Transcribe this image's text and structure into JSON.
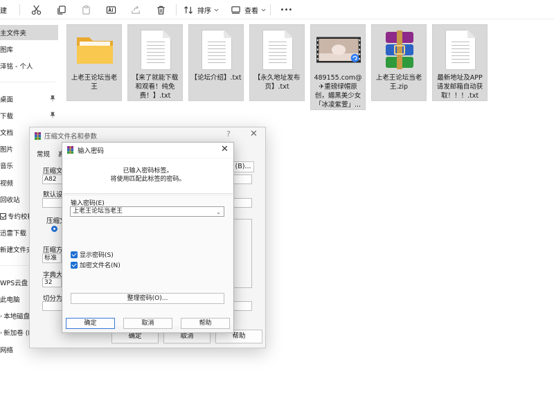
{
  "toolbar": {
    "new_partial": "建",
    "sort_label": "排序",
    "view_label": "查看",
    "more_label": "..."
  },
  "sidebar": {
    "items": [
      {
        "label": "主文件夹",
        "selected": true
      },
      {
        "label": "图库"
      },
      {
        "label": "泽铭 - 个人"
      },
      {
        "label": "桌面",
        "pinned": true
      },
      {
        "label": "下载",
        "pinned": true
      },
      {
        "label": "文档"
      },
      {
        "label": "图片"
      },
      {
        "label": "音乐"
      },
      {
        "label": "视频"
      },
      {
        "label": "回收站"
      },
      {
        "label": "专约校稿",
        "checkbox": true
      },
      {
        "label": "迅雷下载"
      },
      {
        "label": "新建文件夹"
      },
      {
        "label": "WPS云盘"
      },
      {
        "label": "此电脑"
      },
      {
        "label": "本地磁盘"
      },
      {
        "label": "新加卷 (D"
      },
      {
        "label": "网络"
      }
    ]
  },
  "files": [
    {
      "name": "上老王论坛当老王",
      "type": "folder"
    },
    {
      "name": "【来了就能下载和观看！纯免费！】.txt",
      "type": "txt"
    },
    {
      "name": "【论坛介绍】.txt",
      "type": "txt"
    },
    {
      "name": "【永久地址发布页】.txt",
      "type": "txt"
    },
    {
      "name": "489155.com@✈重磅绿帽原创，媚黑美少女「冰凌紫萱」...",
      "type": "video"
    },
    {
      "name": "上老王论坛当老王.zip",
      "type": "zip"
    },
    {
      "name": "最新地址及APP请发邮箱自动获取！！！.txt",
      "type": "txt"
    }
  ],
  "bg_dialog": {
    "title": "压缩文件名和参数",
    "help_mark": "?",
    "tab_general": "常规",
    "tab_partial": "高",
    "archive_name_label": "压缩文",
    "archive_name_value": "A82",
    "browse_partial": "(B)...",
    "default_label": "默认设置",
    "format_label": "压缩文",
    "method_label": "压缩方式",
    "method_value": "标准",
    "dict_label": "字典大小",
    "dict_value": "32",
    "split_label": "切分为分",
    "ok": "确定",
    "cancel": "取消",
    "help": "帮助"
  },
  "pw_dialog": {
    "title": "输入密码",
    "info_line1": "已输入密码标签。",
    "info_line2": "将使用匹配此标签的密码。",
    "password_label": "输入密码(E)",
    "password_value": "上老王论坛当老王",
    "show_password": "显示密码(S)",
    "encrypt_names": "加密文件名(N)",
    "organize": "整理密码(O)...",
    "ok": "确定",
    "cancel": "取消",
    "help": "帮助"
  }
}
